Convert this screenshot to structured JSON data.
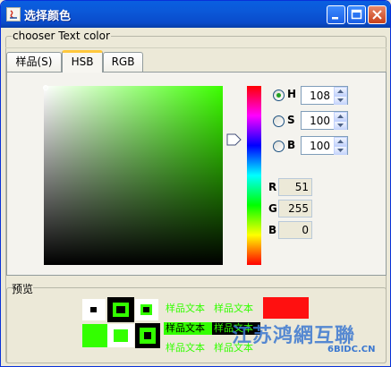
{
  "window": {
    "title": "选择颜色",
    "controls": [
      "minimize-icon",
      "maximize-icon",
      "close-icon"
    ]
  },
  "chooser": {
    "label": "chooser Text color"
  },
  "tabs": [
    {
      "label": "样品(S)",
      "active": false
    },
    {
      "label": "HSB",
      "active": true
    },
    {
      "label": "RGB",
      "active": false
    }
  ],
  "hsb": {
    "h": {
      "label": "H",
      "value": "108",
      "selected": true
    },
    "s": {
      "label": "S",
      "value": "100",
      "selected": false
    },
    "b": {
      "label": "B",
      "value": "100",
      "selected": false
    }
  },
  "rgb": {
    "r": {
      "label": "R",
      "value": "51"
    },
    "g": {
      "label": "G",
      "value": "255"
    },
    "b": {
      "label": "B",
      "value": "0"
    }
  },
  "preview": {
    "label": "预览",
    "sample_text": "样品文本",
    "selected_color": "#33ff00",
    "previous_color": "#ff1010"
  },
  "watermark": {
    "main": "江苏鸿網互聯",
    "sub": "6BIDC.CN"
  },
  "colors": {
    "title_bar": "#0a5fe0",
    "tab_highlight": "#ffc83c"
  }
}
